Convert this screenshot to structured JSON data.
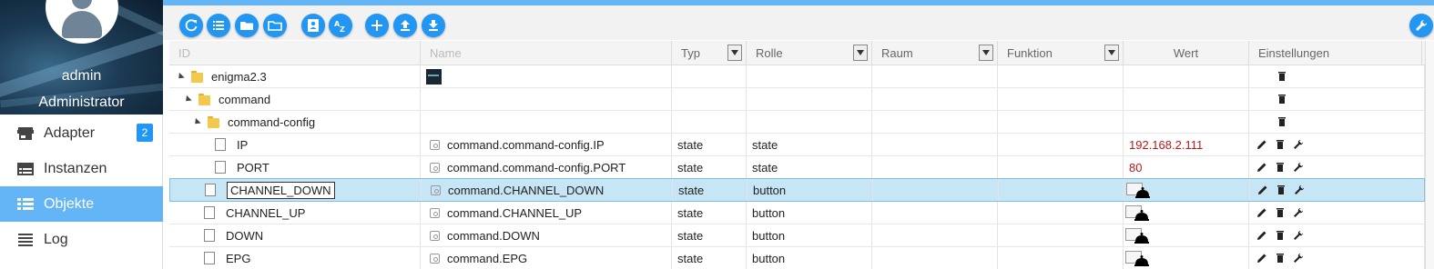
{
  "user": {
    "name": "admin",
    "role": "Administrator"
  },
  "nav": [
    {
      "label": "Adapter",
      "icon": "store-icon",
      "badge": "2",
      "active": false
    },
    {
      "label": "Instanzen",
      "icon": "instances-icon",
      "active": false
    },
    {
      "label": "Objekte",
      "icon": "list-icon",
      "active": true
    },
    {
      "label": "Log",
      "icon": "log-icon",
      "active": false
    }
  ],
  "toolbar": {
    "buttons": [
      "refresh-icon",
      "list-view-icon",
      "folder-icon",
      "folder-open-icon",
      "contact-icon",
      "sort-az-icon",
      "add-icon",
      "upload-icon",
      "download-icon"
    ],
    "settings_icon": "wrench-icon"
  },
  "columns": {
    "id": "ID",
    "name": "Name",
    "typ": "Typ",
    "rolle": "Rolle",
    "raum": "Raum",
    "funktion": "Funktion",
    "wert": "Wert",
    "einstellungen": "Einstellungen"
  },
  "rows": [
    {
      "id": "enigma2.3",
      "kind": "folder",
      "name": "",
      "typ": "",
      "rolle": "",
      "wert": ""
    },
    {
      "id": "command",
      "kind": "folder",
      "name": "",
      "typ": "",
      "rolle": "",
      "wert": ""
    },
    {
      "id": "command-config",
      "kind": "folder",
      "name": "",
      "typ": "",
      "rolle": "",
      "wert": ""
    },
    {
      "id": "IP",
      "kind": "state",
      "name": "command.command-config.IP",
      "typ": "state",
      "rolle": "state",
      "wert": "192.168.2.111"
    },
    {
      "id": "PORT",
      "kind": "state",
      "name": "command.command-config.PORT",
      "typ": "state",
      "rolle": "state",
      "wert": "80"
    },
    {
      "id": "CHANNEL_DOWN",
      "kind": "state",
      "name": "command.CHANNEL_DOWN",
      "typ": "state",
      "rolle": "button",
      "wert": ""
    },
    {
      "id": "CHANNEL_UP",
      "kind": "state",
      "name": "command.CHANNEL_UP",
      "typ": "state",
      "rolle": "button",
      "wert": ""
    },
    {
      "id": "DOWN",
      "kind": "state",
      "name": "command.DOWN",
      "typ": "state",
      "rolle": "button",
      "wert": ""
    },
    {
      "id": "EPG",
      "kind": "state",
      "name": "command.EPG",
      "typ": "state",
      "rolle": "button",
      "wert": ""
    }
  ],
  "colors": {
    "accent": "#2196f3",
    "topbar": "#64b5f6",
    "value_red": "#b71c1c",
    "selected_row": "#c7e6f5"
  }
}
